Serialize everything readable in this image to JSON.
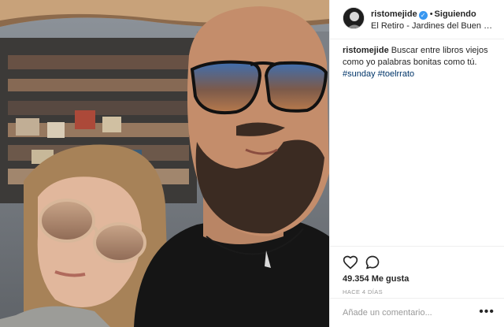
{
  "post": {
    "username": "ristomejide",
    "verified_glyph": "✓",
    "dot": "•",
    "follow_label": "Siguiendo",
    "location": "El Retiro - Jardines del Buen Retiro de Madrid",
    "caption_text": "Buscar entre libros viejos como yo palabras bonitas como tú.",
    "hashtags": [
      "#sunday",
      "#toelrrato"
    ],
    "likes": "49.354 Me gusta",
    "time_ago": "HACE 4 DÍAS",
    "comment_placeholder": "Añade un comentario...",
    "more_glyph": "•••"
  },
  "icons": {
    "like": "heart-icon",
    "comment": "comment-bubble-icon",
    "verified": "verified-badge-icon",
    "more": "more-options-icon"
  },
  "colors": {
    "link": "#003569",
    "verified": "#3897f0",
    "muted": "#999999",
    "border": "#efefef"
  }
}
